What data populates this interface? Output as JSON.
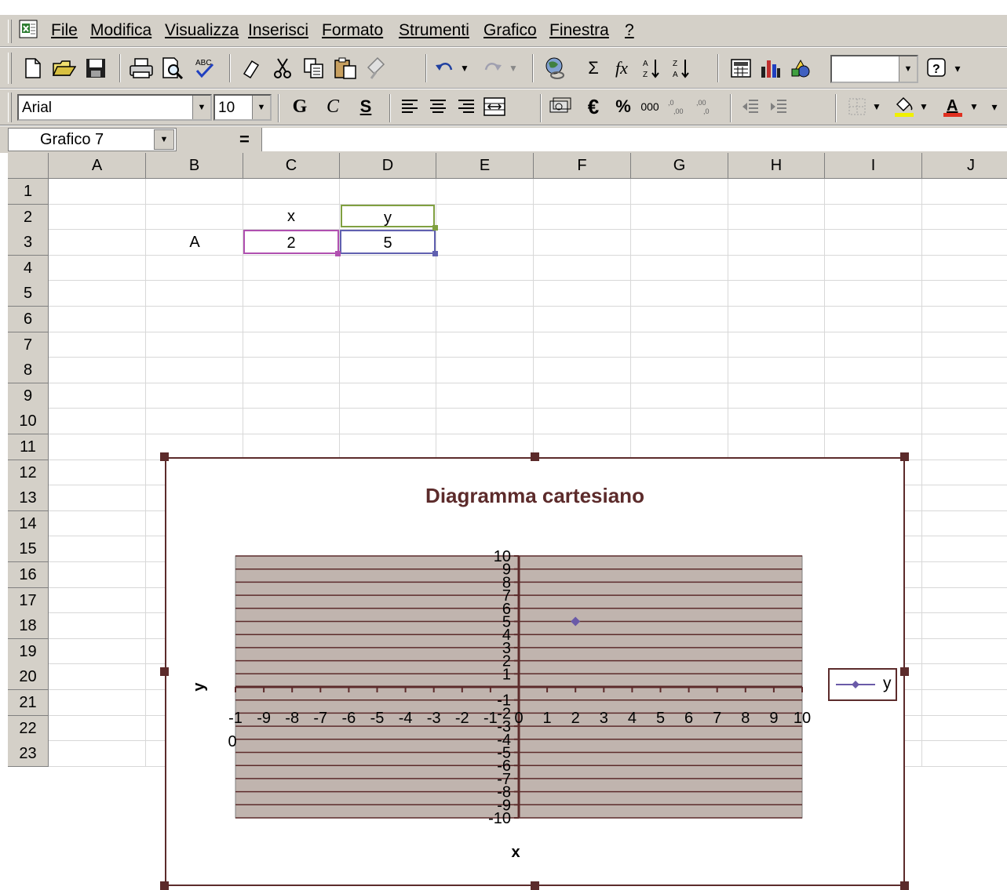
{
  "menu": {
    "items": [
      {
        "name": "file",
        "label": "File"
      },
      {
        "name": "modifica",
        "label": "Modifica"
      },
      {
        "name": "visualizza",
        "label": "Visualizza"
      },
      {
        "name": "inserisci",
        "label": "Inserisci"
      },
      {
        "name": "formato",
        "label": "Formato"
      },
      {
        "name": "strumenti",
        "label": "Strumenti"
      },
      {
        "name": "grafico",
        "label": "Grafico"
      },
      {
        "name": "finestra",
        "label": "Finestra"
      },
      {
        "name": "help",
        "label": "?"
      }
    ]
  },
  "formatting": {
    "font_name": "Arial",
    "font_size": "10",
    "bold_label": "G",
    "italic_label": "C",
    "underline_label": "S",
    "euro_label": "€",
    "percent_label": "%",
    "thousands_label": "000"
  },
  "formula_bar": {
    "name_box": "Grafico 7",
    "equals": "="
  },
  "sheet": {
    "columns": [
      "A",
      "B",
      "C",
      "D",
      "E",
      "F",
      "G",
      "H",
      "I",
      "J"
    ],
    "rows": [
      "1",
      "2",
      "3",
      "4",
      "5",
      "6",
      "7",
      "8",
      "9",
      "10",
      "11",
      "12",
      "13",
      "14",
      "15",
      "16",
      "17",
      "18",
      "19",
      "20",
      "21",
      "22",
      "23"
    ],
    "cells": {
      "C2": "x",
      "D2": "y",
      "B3": "A",
      "C3": "2",
      "D3": "5"
    },
    "colors": {
      "x_range": "#b050b0",
      "y_header_range": "#80a040",
      "y_range": "#6060b0"
    }
  },
  "chart_data": {
    "type": "scatter",
    "title": "Diagramma cartesiano",
    "xlabel": "x",
    "ylabel": "y",
    "xlim": [
      -10,
      10
    ],
    "ylim": [
      -10,
      10
    ],
    "x_ticks": [
      "-1",
      "-9",
      "-8",
      "-7",
      "-6",
      "-5",
      "-4",
      "-3",
      "-2",
      "-1",
      "0",
      "1",
      "2",
      "3",
      "4",
      "5",
      "6",
      "7",
      "8",
      "9",
      "10"
    ],
    "x_ticks_wrap": "0",
    "y_ticks_pos": [
      "10",
      "9",
      "8",
      "7",
      "6",
      "5",
      "4",
      "3",
      "2",
      "1"
    ],
    "y_ticks_neg": [
      "-1",
      "-2",
      "-3",
      "-4",
      "-5",
      "-6",
      "-7",
      "-8",
      "-9",
      "-10"
    ],
    "grid": true,
    "plot_bg": "#c0b4ae",
    "axis_color": "#5c2b2b",
    "legend_position": "right",
    "series": [
      {
        "name": "y",
        "x": [
          2
        ],
        "y": [
          5
        ],
        "color": "#6a5aa8"
      }
    ]
  }
}
